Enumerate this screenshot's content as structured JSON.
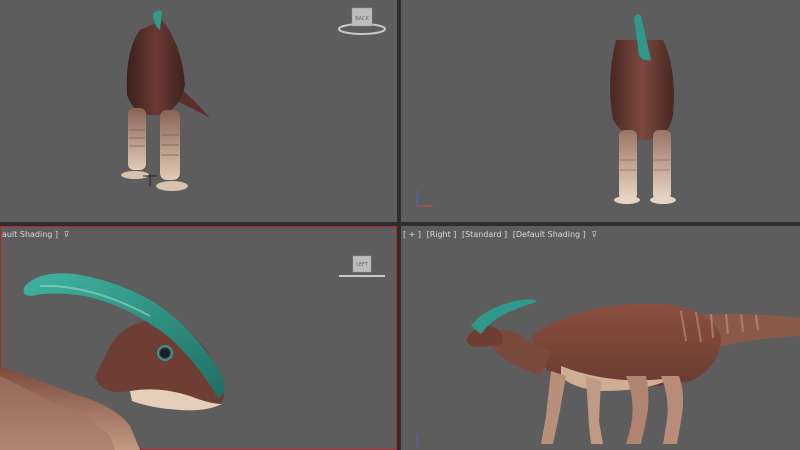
{
  "viewports": {
    "top_left": {
      "viewcube_label": "BACK"
    },
    "top_right": {},
    "bottom_left": {
      "label": {
        "shading": "ault Shading ]",
        "toggle": "⊽"
      },
      "viewcube_label": "LEFT"
    },
    "bottom_right": {
      "label": {
        "plus": "[ + ]",
        "view": "[Right ]",
        "mode": "[Standard ]",
        "shading": "[Default Shading ]",
        "toggle": "⊽"
      }
    }
  },
  "colors": {
    "viewport_bg": "#5d5d5d",
    "active_border": "#b3262e",
    "crest_teal": "#2f9a8a",
    "skin_brown": "#6e3e35",
    "belly_cream": "#d8bea5"
  }
}
